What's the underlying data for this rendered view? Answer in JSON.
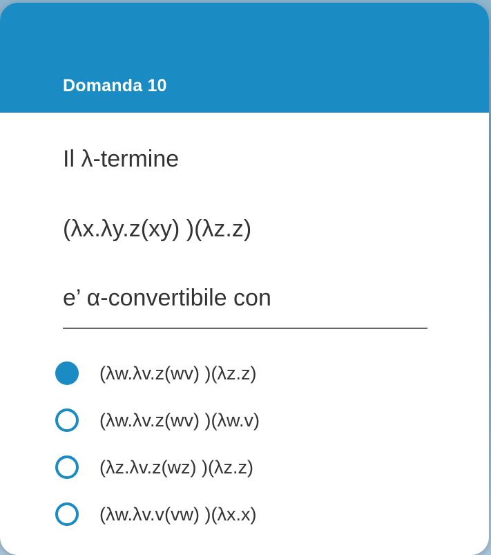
{
  "dialog": {
    "title": "Domanda 10"
  },
  "question": {
    "line1": "Il λ-termine",
    "line2": "(λx.λy.z(xy) )(λz.z)",
    "line3": "e’ α-convertibile con"
  },
  "options": [
    {
      "label": "(λw.λv.z(wv) )(λz.z)",
      "selected": true
    },
    {
      "label": "(λw.λv.z(wv) )(λw.v)",
      "selected": false
    },
    {
      "label": "(λz.λv.z(wz) )(λz.z)",
      "selected": false
    },
    {
      "label": "(λw.λv.v(vw) )(λx.x)",
      "selected": false
    }
  ],
  "colors": {
    "accent": "#1b8bc3",
    "text": "#333333",
    "header_text": "#ffffff"
  }
}
